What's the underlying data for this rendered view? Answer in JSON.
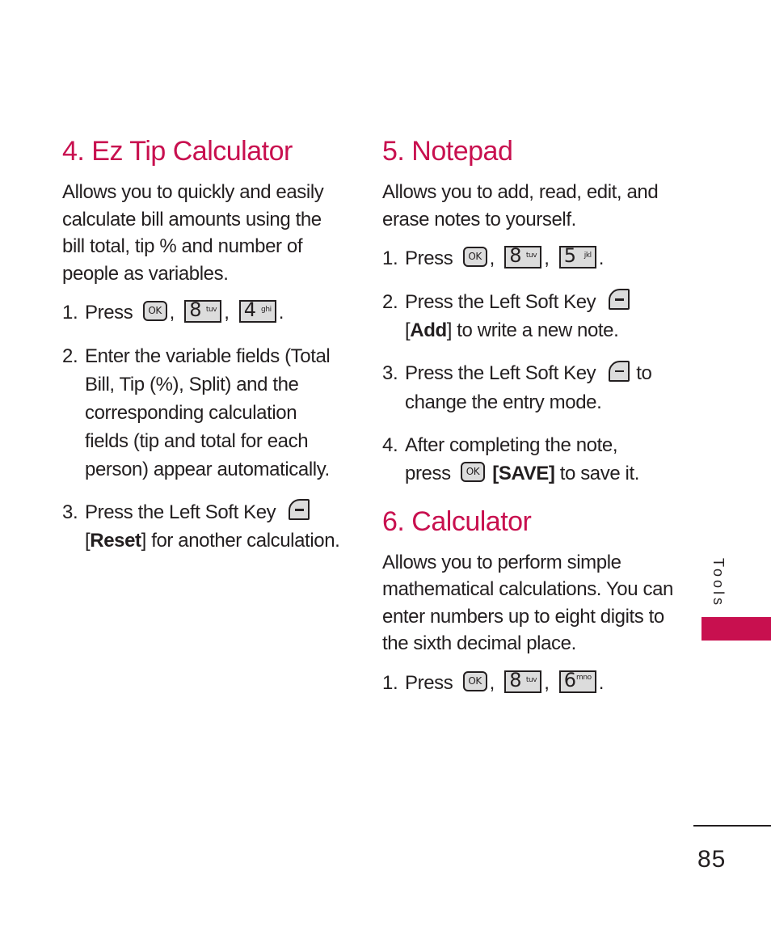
{
  "left_column": {
    "title": "4. Ez Tip Calculator",
    "description": "Allows you to quickly and easily calculate bill amounts using the bill total, tip % and number of people as variables.",
    "steps": [
      {
        "number": "1.",
        "text_before": "Press",
        "keys": [
          {
            "type": "ok",
            "label": "OK"
          },
          {
            "type": "num",
            "digit": "8",
            "letters": "tuv"
          },
          {
            "type": "num",
            "digit": "4",
            "letters": "ghi"
          }
        ]
      },
      {
        "number": "2.",
        "text": "Enter the variable fields (Total Bill, Tip (%), Split) and the corresponding calculation fields (tip and total for each person) appear automatically."
      },
      {
        "number": "3.",
        "text_before": "Press the Left Soft Key",
        "key": "left-soft-key",
        "bracket_open": "[",
        "bold": "Reset",
        "bracket_close": "]",
        "text_after": " for another calculation."
      }
    ]
  },
  "notepad": {
    "title": "5. Notepad",
    "description": "Allows you to add, read, edit, and erase notes to yourself.",
    "steps": [
      {
        "number": "1.",
        "text_before": "Press",
        "keys": [
          {
            "type": "ok",
            "label": "OK"
          },
          {
            "type": "num",
            "digit": "8",
            "letters": "tuv"
          },
          {
            "type": "num",
            "digit": "5",
            "letters": "jkl"
          }
        ]
      },
      {
        "number": "2.",
        "text_before": "Press the Left Soft Key",
        "bracket_open": "[",
        "bold": "Add",
        "bracket_close": "]",
        "text_after": " to write a new note."
      },
      {
        "number": "3.",
        "text_before": "Press the Left Soft Key",
        "text_mid": "to",
        "text_after": "change the entry mode."
      },
      {
        "number": "4.",
        "text_before": "After completing the note,",
        "text_press": "press",
        "bold": "[SAVE]",
        "text_after": " to save it."
      }
    ]
  },
  "calculator": {
    "title": "6. Calculator",
    "description": "Allows you to perform simple mathematical calculations. You can enter numbers up to eight digits to the sixth decimal place.",
    "steps": [
      {
        "number": "1.",
        "text_before": "Press",
        "keys": [
          {
            "type": "ok",
            "label": "OK"
          },
          {
            "type": "num",
            "digit": "8",
            "letters": "tuv"
          },
          {
            "type": "num",
            "digit": "6",
            "letters": "mno"
          }
        ]
      }
    ]
  },
  "sidebar": {
    "section_label": "Tools",
    "tab_color": "#c8104f"
  },
  "footer": {
    "page_number": "85"
  },
  "punctuation": {
    "comma": ",",
    "period": "."
  },
  "colors": {
    "heading": "#c8104f",
    "text": "#231f20"
  }
}
